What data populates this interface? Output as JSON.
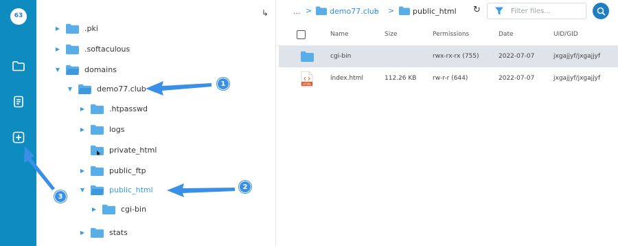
{
  "rail": {
    "logo_text": "63",
    "items": [
      {
        "icon": "folder-icon"
      },
      {
        "icon": "document-icon"
      },
      {
        "icon": "plus-square-icon"
      }
    ]
  },
  "tree": {
    "up_icon": "↳",
    "nodes": [
      {
        "label": ".pki",
        "expanded": false,
        "has_toggle": true
      },
      {
        "label": ".softaculous",
        "expanded": false,
        "has_toggle": true
      },
      {
        "label": "domains",
        "expanded": true,
        "has_toggle": true
      },
      {
        "label": "demo77.club",
        "expanded": true,
        "has_toggle": true
      },
      {
        "label": ".htpasswd",
        "expanded": false,
        "has_toggle": true
      },
      {
        "label": "logs",
        "expanded": false,
        "has_toggle": true
      },
      {
        "label": "private_html",
        "expanded": false,
        "has_toggle": false
      },
      {
        "label": "public_ftp",
        "expanded": false,
        "has_toggle": true
      },
      {
        "label": "public_html",
        "expanded": true,
        "has_toggle": true,
        "active": true
      },
      {
        "label": "cgi-bin",
        "expanded": false,
        "has_toggle": true
      },
      {
        "label": "stats",
        "expanded": false,
        "has_toggle": true
      }
    ]
  },
  "breadcrumb": {
    "ellipsis": "...",
    "items": [
      "demo77.club",
      "public_html"
    ],
    "caret": "⌄"
  },
  "toolbar": {
    "refresh_icon": "↻",
    "filter_placeholder": "Filter files..."
  },
  "table": {
    "columns": [
      "Name",
      "Size",
      "Permissions",
      "Date",
      "UID/GID"
    ],
    "rows": [
      {
        "type": "folder",
        "name": "cgi-bin",
        "size": "",
        "permissions": "rwx-rx-rx (755)",
        "date": "2022-07-07",
        "uidgid": "jxgajjyf/jxgajjyf",
        "selected": true
      },
      {
        "type": "html",
        "name": "index.html",
        "size": "112.26 KB",
        "permissions": "rw-r-r (644)",
        "date": "2022-07-07",
        "uidgid": "jxgajjyf/jxgajjyf",
        "selected": false,
        "icon_label": "HTML"
      }
    ]
  },
  "annotations": {
    "badges": [
      "1",
      "2",
      "3"
    ]
  },
  "colors": {
    "rail": "#0e8cbf",
    "accent": "#3a9be0",
    "folder": "#5aaee8",
    "selected_row": "#dfe3ea",
    "annotation": "#3a8fe6"
  }
}
